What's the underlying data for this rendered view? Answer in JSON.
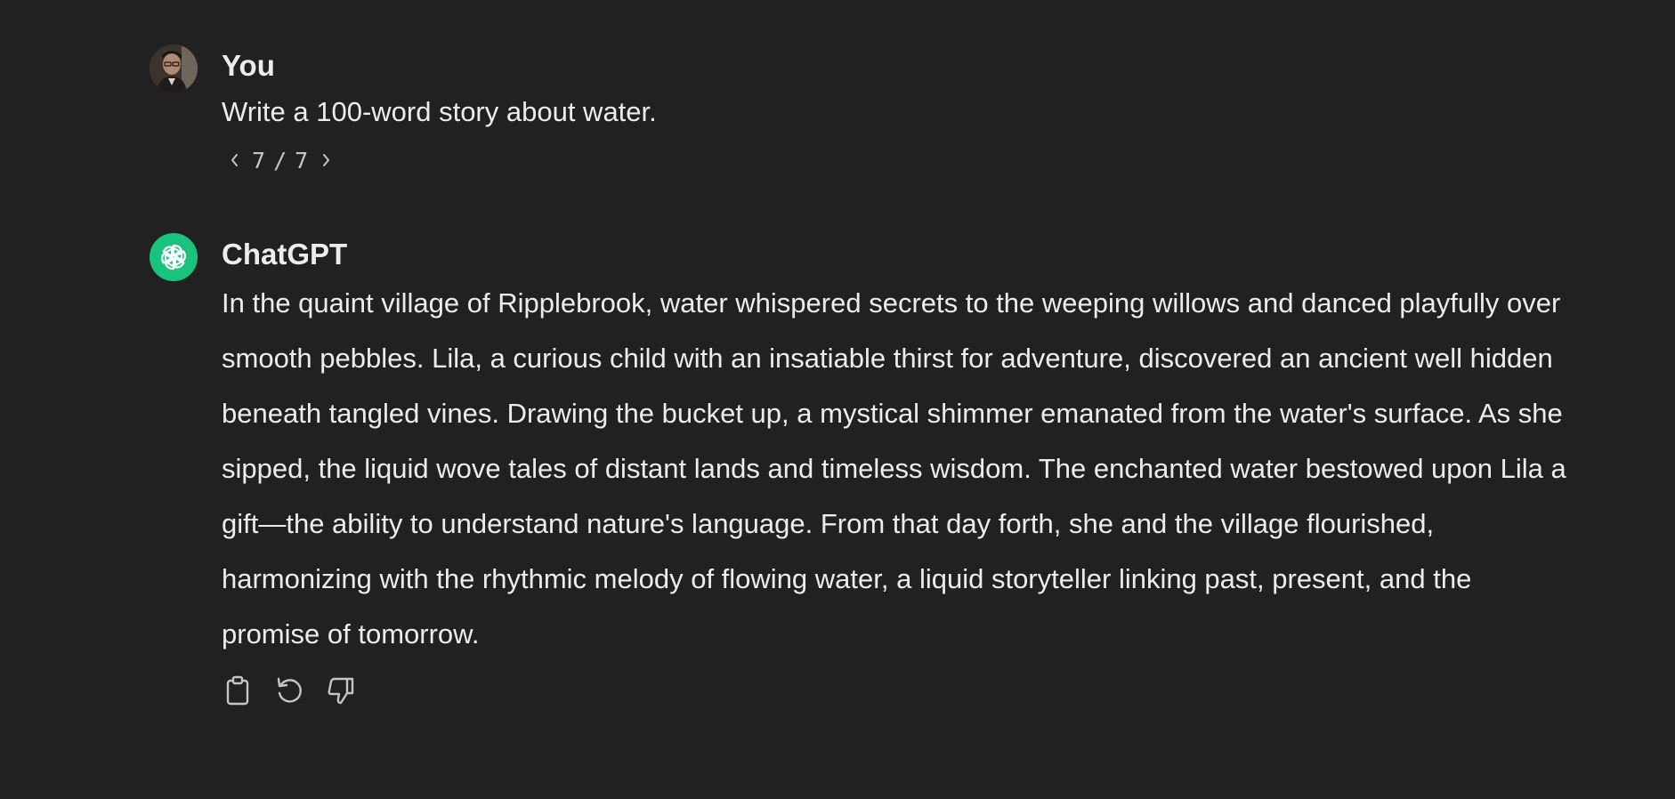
{
  "conversation": {
    "user_message": {
      "author": "You",
      "text": "Write a 100-word story about water.",
      "pager": {
        "prev_icon": "chevron-left-icon",
        "current": "7",
        "separator": "/",
        "total": "7",
        "next_icon": "chevron-right-icon"
      }
    },
    "assistant_message": {
      "author": "ChatGPT",
      "text": "In the quaint village of Ripplebrook, water whispered secrets to the weeping willows and danced playfully over smooth pebbles. Lila, a curious child with an insatiable thirst for adventure, discovered an ancient well hidden beneath tangled vines. Drawing the bucket up, a mystical shimmer emanated from the water's surface. As she sipped, the liquid wove tales of distant lands and timeless wisdom. The enchanted water bestowed upon Lila a gift—the ability to understand nature's language. From that day forth, she and the village flourished, harmonizing with the rhythmic melody of flowing water, a liquid storyteller linking past, present, and the promise of tomorrow.",
      "actions": [
        {
          "name": "copy",
          "icon": "clipboard-icon"
        },
        {
          "name": "regenerate",
          "icon": "regenerate-icon"
        },
        {
          "name": "thumbs-down",
          "icon": "thumbs-down-icon"
        }
      ]
    }
  },
  "colors": {
    "background": "#212121",
    "text": "#ececec",
    "muted": "#c5c5c5",
    "brand": "#19c37d"
  }
}
